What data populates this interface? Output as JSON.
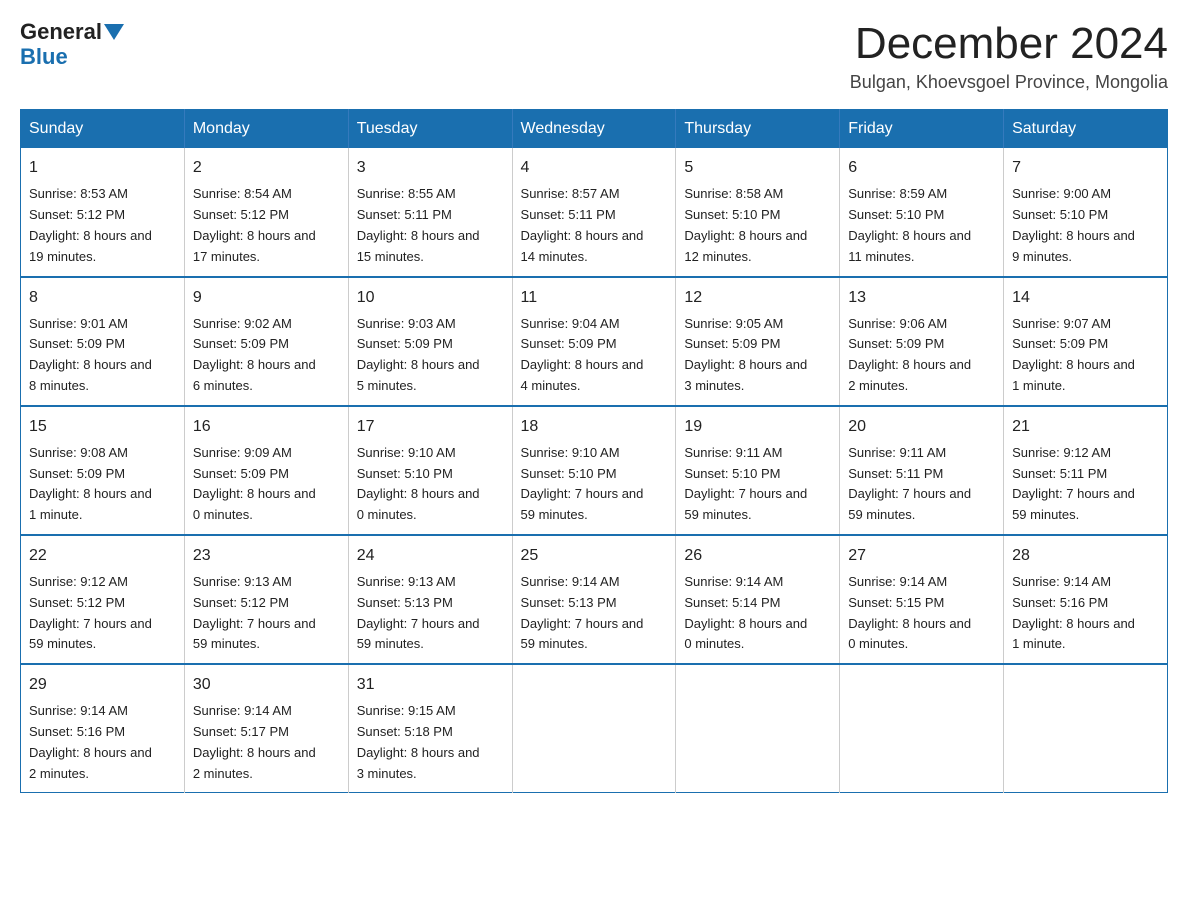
{
  "logo": {
    "general": "General",
    "blue": "Blue"
  },
  "title": "December 2024",
  "subtitle": "Bulgan, Khoevsgoel Province, Mongolia",
  "weekdays": [
    "Sunday",
    "Monday",
    "Tuesday",
    "Wednesday",
    "Thursday",
    "Friday",
    "Saturday"
  ],
  "weeks": [
    [
      {
        "day": "1",
        "sunrise": "8:53 AM",
        "sunset": "5:12 PM",
        "daylight": "8 hours and 19 minutes."
      },
      {
        "day": "2",
        "sunrise": "8:54 AM",
        "sunset": "5:12 PM",
        "daylight": "8 hours and 17 minutes."
      },
      {
        "day": "3",
        "sunrise": "8:55 AM",
        "sunset": "5:11 PM",
        "daylight": "8 hours and 15 minutes."
      },
      {
        "day": "4",
        "sunrise": "8:57 AM",
        "sunset": "5:11 PM",
        "daylight": "8 hours and 14 minutes."
      },
      {
        "day": "5",
        "sunrise": "8:58 AM",
        "sunset": "5:10 PM",
        "daylight": "8 hours and 12 minutes."
      },
      {
        "day": "6",
        "sunrise": "8:59 AM",
        "sunset": "5:10 PM",
        "daylight": "8 hours and 11 minutes."
      },
      {
        "day": "7",
        "sunrise": "9:00 AM",
        "sunset": "5:10 PM",
        "daylight": "8 hours and 9 minutes."
      }
    ],
    [
      {
        "day": "8",
        "sunrise": "9:01 AM",
        "sunset": "5:09 PM",
        "daylight": "8 hours and 8 minutes."
      },
      {
        "day": "9",
        "sunrise": "9:02 AM",
        "sunset": "5:09 PM",
        "daylight": "8 hours and 6 minutes."
      },
      {
        "day": "10",
        "sunrise": "9:03 AM",
        "sunset": "5:09 PM",
        "daylight": "8 hours and 5 minutes."
      },
      {
        "day": "11",
        "sunrise": "9:04 AM",
        "sunset": "5:09 PM",
        "daylight": "8 hours and 4 minutes."
      },
      {
        "day": "12",
        "sunrise": "9:05 AM",
        "sunset": "5:09 PM",
        "daylight": "8 hours and 3 minutes."
      },
      {
        "day": "13",
        "sunrise": "9:06 AM",
        "sunset": "5:09 PM",
        "daylight": "8 hours and 2 minutes."
      },
      {
        "day": "14",
        "sunrise": "9:07 AM",
        "sunset": "5:09 PM",
        "daylight": "8 hours and 1 minute."
      }
    ],
    [
      {
        "day": "15",
        "sunrise": "9:08 AM",
        "sunset": "5:09 PM",
        "daylight": "8 hours and 1 minute."
      },
      {
        "day": "16",
        "sunrise": "9:09 AM",
        "sunset": "5:09 PM",
        "daylight": "8 hours and 0 minutes."
      },
      {
        "day": "17",
        "sunrise": "9:10 AM",
        "sunset": "5:10 PM",
        "daylight": "8 hours and 0 minutes."
      },
      {
        "day": "18",
        "sunrise": "9:10 AM",
        "sunset": "5:10 PM",
        "daylight": "7 hours and 59 minutes."
      },
      {
        "day": "19",
        "sunrise": "9:11 AM",
        "sunset": "5:10 PM",
        "daylight": "7 hours and 59 minutes."
      },
      {
        "day": "20",
        "sunrise": "9:11 AM",
        "sunset": "5:11 PM",
        "daylight": "7 hours and 59 minutes."
      },
      {
        "day": "21",
        "sunrise": "9:12 AM",
        "sunset": "5:11 PM",
        "daylight": "7 hours and 59 minutes."
      }
    ],
    [
      {
        "day": "22",
        "sunrise": "9:12 AM",
        "sunset": "5:12 PM",
        "daylight": "7 hours and 59 minutes."
      },
      {
        "day": "23",
        "sunrise": "9:13 AM",
        "sunset": "5:12 PM",
        "daylight": "7 hours and 59 minutes."
      },
      {
        "day": "24",
        "sunrise": "9:13 AM",
        "sunset": "5:13 PM",
        "daylight": "7 hours and 59 minutes."
      },
      {
        "day": "25",
        "sunrise": "9:14 AM",
        "sunset": "5:13 PM",
        "daylight": "7 hours and 59 minutes."
      },
      {
        "day": "26",
        "sunrise": "9:14 AM",
        "sunset": "5:14 PM",
        "daylight": "8 hours and 0 minutes."
      },
      {
        "day": "27",
        "sunrise": "9:14 AM",
        "sunset": "5:15 PM",
        "daylight": "8 hours and 0 minutes."
      },
      {
        "day": "28",
        "sunrise": "9:14 AM",
        "sunset": "5:16 PM",
        "daylight": "8 hours and 1 minute."
      }
    ],
    [
      {
        "day": "29",
        "sunrise": "9:14 AM",
        "sunset": "5:16 PM",
        "daylight": "8 hours and 2 minutes."
      },
      {
        "day": "30",
        "sunrise": "9:14 AM",
        "sunset": "5:17 PM",
        "daylight": "8 hours and 2 minutes."
      },
      {
        "day": "31",
        "sunrise": "9:15 AM",
        "sunset": "5:18 PM",
        "daylight": "8 hours and 3 minutes."
      },
      null,
      null,
      null,
      null
    ]
  ],
  "labels": {
    "sunrise": "Sunrise:",
    "sunset": "Sunset:",
    "daylight": "Daylight:"
  }
}
